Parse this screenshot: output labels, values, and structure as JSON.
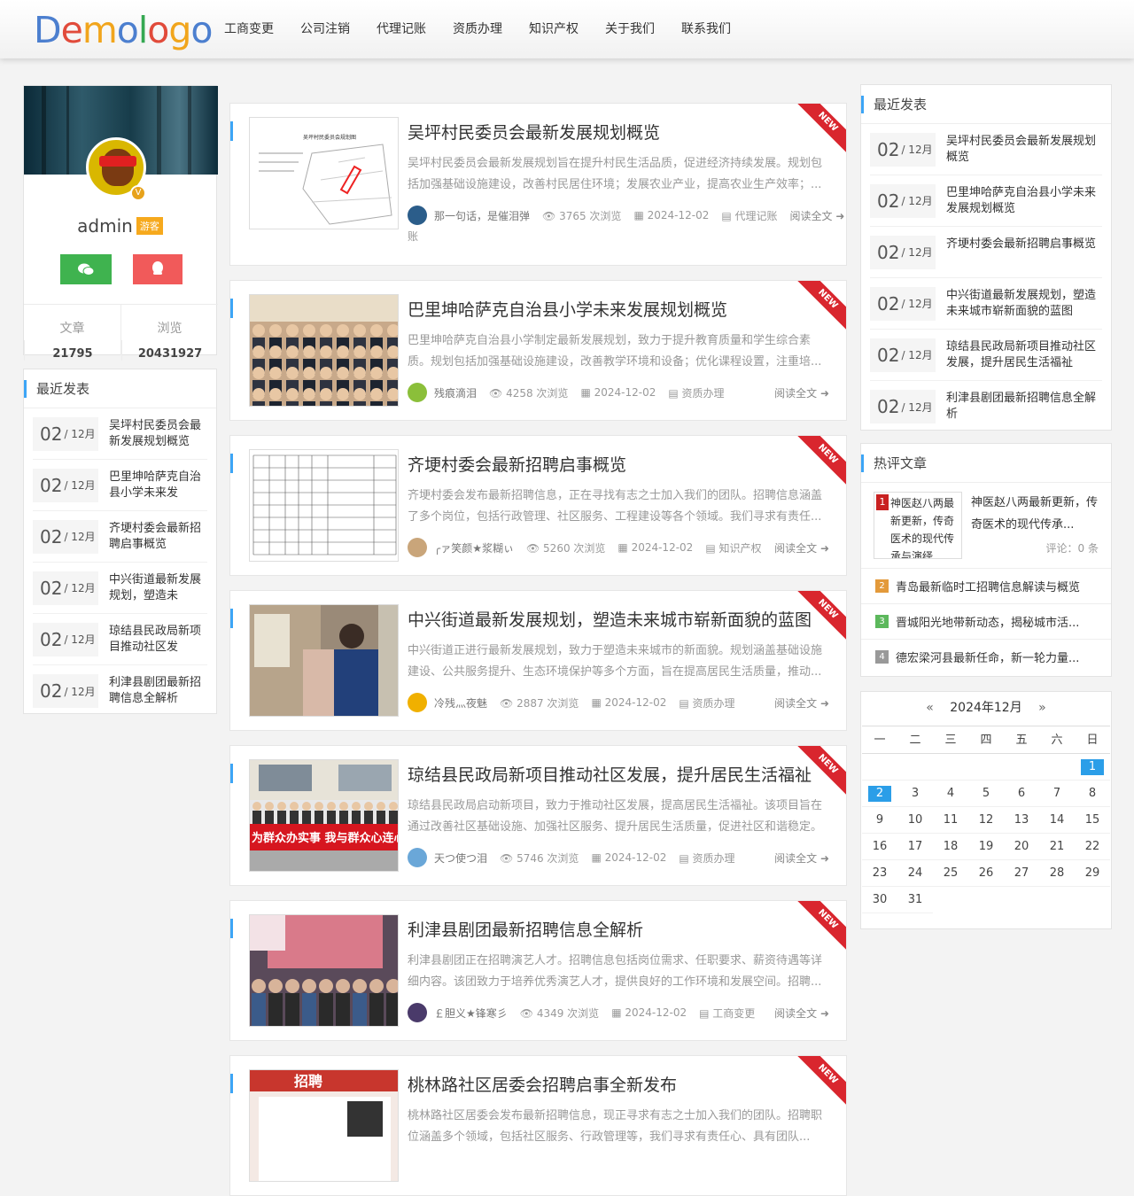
{
  "site": {
    "logo": "Demologo",
    "nav": [
      "工商变更",
      "公司注销",
      "代理记账",
      "资质办理",
      "知识产权",
      "关于我们",
      "联系我们"
    ]
  },
  "profile": {
    "name": "admin",
    "role_tag": "游客",
    "posts_label": "文章",
    "posts": "21795",
    "views_label": "浏览",
    "views": "20431927",
    "wechat_icon": "wechat-icon",
    "qq_icon": "qq-icon"
  },
  "left_recent": {
    "title": "最近发表",
    "items": [
      {
        "day": "02",
        "month": "/ 12月",
        "title": "吴坪村民委员会最新发展规划概览"
      },
      {
        "day": "02",
        "month": "/ 12月",
        "title": "巴里坤哈萨克自治县小学未来发"
      },
      {
        "day": "02",
        "month": "/ 12月",
        "title": "齐埂村委会最新招聘启事概览"
      },
      {
        "day": "02",
        "month": "/ 12月",
        "title": "中兴街道最新发展规划，塑造未"
      },
      {
        "day": "02",
        "month": "/ 12月",
        "title": "琼结县民政局新项目推动社区发"
      },
      {
        "day": "02",
        "month": "/ 12月",
        "title": "利津县剧团最新招聘信息全解析"
      }
    ]
  },
  "articles": [
    {
      "title": "吴坪村民委员会最新发展规划概览",
      "summary": "吴坪村民委员会最新发展规划旨在提升村民生活品质，促进经济持续发展。规划包括加强基础设施建设，改善村民居住环境；发展农业产业，提高农业生产效率；...",
      "author": "那一句话，是催泪弹",
      "views": "3765 次浏览",
      "date": "2024-12-02",
      "category": "代理记账",
      "read_more": "阅读全文",
      "ribbon": "NEW",
      "avatar_color": "#2b5d8a",
      "thumb": "map"
    },
    {
      "title": "巴里坤哈萨克自治县小学未来发展规划概览",
      "summary": "巴里坤哈萨克自治县小学制定最新发展规划，致力于提升教育质量和学生综合素质。规划包括加强基础设施建设，改善教学环境和设备；优化课程设置，注重培...",
      "author": "残痕滴泪",
      "views": "4258 次浏览",
      "date": "2024-12-02",
      "category": "资质办理",
      "read_more": "阅读全文",
      "ribbon": "NEW",
      "avatar_color": "#8bbf3a",
      "thumb": "crowd"
    },
    {
      "title": "齐埂村委会最新招聘启事概览",
      "summary": "齐埂村委会发布最新招聘信息，正在寻找有志之士加入我们的团队。招聘信息涵盖了多个岗位，包括行政管理、社区服务、工程建设等各个领域。我们寻求有责任...",
      "author": "╭ァ笑颜★浆糊ぃ",
      "views": "5260 次浏览",
      "date": "2024-12-02",
      "category": "知识产权",
      "read_more": "阅读全文",
      "ribbon": "NEW",
      "avatar_color": "#c9a57a",
      "thumb": "table"
    },
    {
      "title": "中兴街道最新发展规划，塑造未来城市崭新面貌的蓝图",
      "summary": "中兴街道正进行最新发展规划，致力于塑造未来城市的新面貌。规划涵盖基础设施建设、公共服务提升、生态环境保护等多个方面，旨在提高居民生活质量，推动...",
      "author": "冷残灬夜魅",
      "views": "2887 次浏览",
      "date": "2024-12-02",
      "category": "资质办理",
      "read_more": "阅读全文",
      "ribbon": "NEW",
      "avatar_color": "#f0b000",
      "thumb": "street"
    },
    {
      "title": "琼结县民政局新项目推动社区发展，提升居民生活福祉",
      "summary": "琼结县民政局启动新项目，致力于推动社区发展，提高居民生活福祉。该项目旨在通过改善社区基础设施、加强社区服务、提升居民生活质量，促进社区和谐稳定。项...",
      "author": "天つ使つ泪",
      "views": "5746 次浏览",
      "date": "2024-12-02",
      "category": "资质办理",
      "read_more": "阅读全文",
      "ribbon": "NEW",
      "avatar_color": "#6aa7d8",
      "thumb": "banner",
      "banner_text": "为群众办实事 我与群众心连心"
    },
    {
      "title": "利津县剧团最新招聘信息全解析",
      "summary": "利津县剧团正在招聘演艺人才。招聘信息包括岗位需求、任职要求、薪资待遇等详细内容。该团致力于培养优秀演艺人才，提供良好的工作环境和发展空间。招聘...",
      "author": "￡胆义★锋寒彡",
      "views": "4349 次浏览",
      "date": "2024-12-02",
      "category": "工商变更",
      "read_more": "阅读全文",
      "ribbon": "NEW",
      "avatar_color": "#4a3a6a",
      "thumb": "stage"
    },
    {
      "title": "桃林路社区居委会招聘启事全新发布",
      "summary": "桃林路社区居委会发布最新招聘信息，现正寻求有志之士加入我们的团队。招聘职位涵盖多个领域，包括社区服务、行政管理等，我们寻求有责任心、具有团队...",
      "author": "",
      "views": "",
      "date": "",
      "category": "",
      "read_more": "",
      "ribbon": "NEW",
      "avatar_color": "#cccccc",
      "thumb": "poster"
    }
  ],
  "right_recent": {
    "title": "最近发表",
    "items": [
      {
        "day": "02",
        "month": "/ 12月",
        "title": "吴坪村民委员会最新发展规划概览"
      },
      {
        "day": "02",
        "month": "/ 12月",
        "title": "巴里坤哈萨克自治县小学未来发展规划概览"
      },
      {
        "day": "02",
        "month": "/ 12月",
        "title": "齐埂村委会最新招聘启事概览"
      },
      {
        "day": "02",
        "month": "/ 12月",
        "title": "中兴街道最新发展规划，塑造未来城市崭新面貌的蓝图"
      },
      {
        "day": "02",
        "month": "/ 12月",
        "title": "琼结县民政局新项目推动社区发展，提升居民生活福祉"
      },
      {
        "day": "02",
        "month": "/ 12月",
        "title": "利津县剧团最新招聘信息全解析"
      }
    ]
  },
  "hot": {
    "title": "热评文章",
    "first": {
      "rank": "1",
      "pic_text": "神医赵八两最新更新，传奇医术的现代传承与演绎",
      "title": "神医赵八两最新更新，传奇医术的现代传承...",
      "comments": "评论：0 条"
    },
    "rows": [
      {
        "rank": "2",
        "color": "#e39a3b",
        "title": "青岛最新临时工招聘信息解读与概览"
      },
      {
        "rank": "3",
        "color": "#5cb85c",
        "title": "晋城阳光地带新动态，揭秘城市活..."
      },
      {
        "rank": "4",
        "color": "#999999",
        "title": "德宏梁河县最新任命，新一轮力量..."
      }
    ]
  },
  "calendar": {
    "title": "2024年12月",
    "prev": "«",
    "next": "»",
    "weekdays": [
      "一",
      "二",
      "三",
      "四",
      "五",
      "六",
      "日"
    ],
    "leading_blanks": 6,
    "days": 31,
    "highlight": [
      1,
      2
    ]
  }
}
